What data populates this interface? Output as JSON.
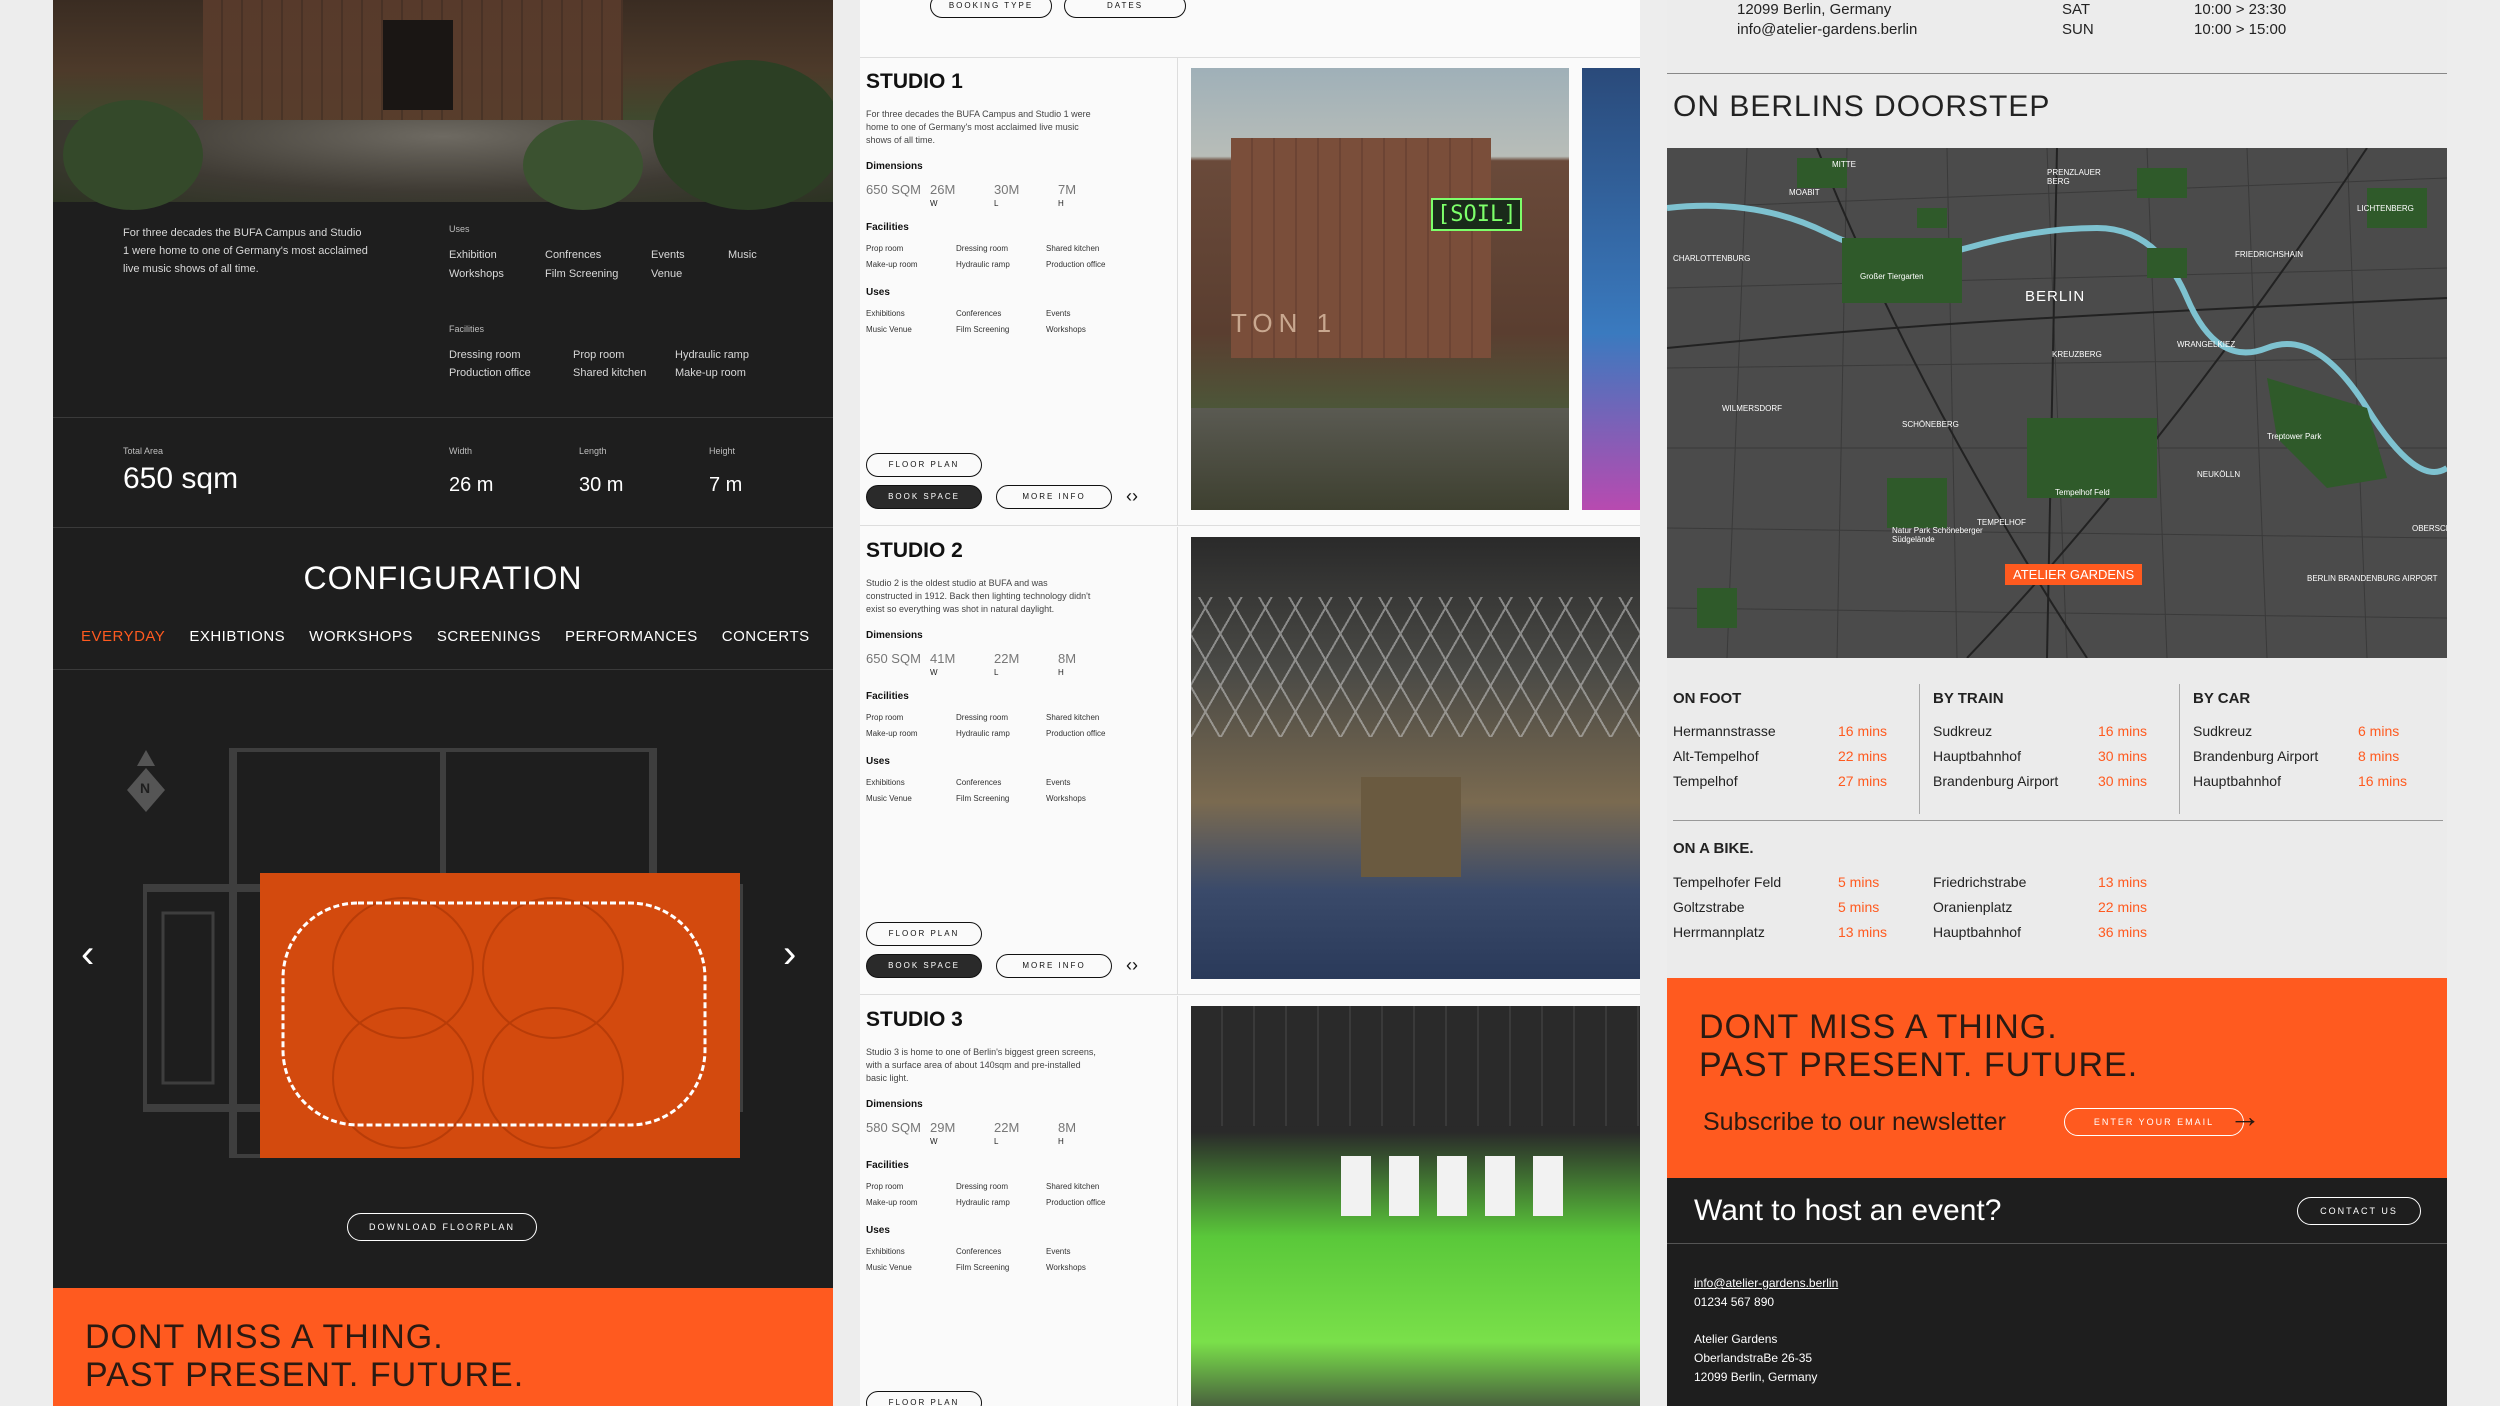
{
  "left": {
    "intro": "For three decades the BUFA Campus and Studio 1 were home to one of Germany's most acclaimed live music shows of all time.",
    "uses_label": "Uses",
    "uses": [
      "Exhibition",
      "Confrences",
      "Events",
      "Music",
      "Workshops",
      "Film Screening",
      "Venue"
    ],
    "facilities_label": "Facilities",
    "facilities": [
      "Dressing room",
      "Prop room",
      "Hydraulic ramp",
      "Production office",
      "Shared kitchen",
      "Make-up room"
    ],
    "total_area_label": "Total Area",
    "total_area": "650 sqm",
    "width_label": "Width",
    "width": "26 m",
    "length_label": "Length",
    "length": "30 m",
    "height_label": "Height",
    "height": "7 m",
    "config_title": "CONFIGURATION",
    "tabs": [
      "EVERYDAY",
      "EXHIBTIONS",
      "WORKSHOPS",
      "SCREENINGS",
      "PERFORMANCES",
      "CONCERTS"
    ],
    "compass": "N",
    "prev": "‹",
    "next": "›",
    "download": "DOWNLOAD FLOORPLAN",
    "newsletter_l1": "DONT MISS A THING.",
    "newsletter_l2": "PAST PRESENT. FUTURE."
  },
  "mid": {
    "booking_type": "BOOKING TYPE",
    "dates": "DATES",
    "floor_plan": "FLOOR PLAN",
    "book_space": "BOOK SPACE",
    "more_info": "MORE INFO",
    "studios": [
      {
        "name": "STUDIO 1",
        "desc": "For three decades the BUFA Campus and Studio 1 were home to one of Germany's most acclaimed live music shows of all time.",
        "dims": [
          "650 SQM",
          "26M",
          "30M",
          "7M"
        ],
        "sign": "[SOIL]",
        "building": "TON 1"
      },
      {
        "name": "STUDIO 2",
        "desc": "Studio 2 is the oldest studio at BUFA and was constructed in 1912. Back then lighting technology didn't exist so everything was shot in natural daylight.",
        "dims": [
          "650 SQM",
          "41M",
          "22M",
          "8M"
        ]
      },
      {
        "name": "STUDIO 3",
        "desc": "Studio 3 is home to one of Berlin's biggest green screens, with a surface area of about 140sqm and pre-installed basic light.",
        "dims": [
          "580 SQM",
          "29M",
          "22M",
          "8M"
        ]
      }
    ],
    "dim_sub": [
      "W",
      "L",
      "H"
    ],
    "dimensions_label": "Dimensions",
    "facilities_label": "Facilities",
    "uses_label": "Uses",
    "facilities": [
      "Prop room",
      "Dressing room",
      "Shared kitchen",
      "Make-up room",
      "Hydraulic ramp",
      "Production office"
    ],
    "uses": [
      "Exhibitions",
      "Conferences",
      "Events",
      "Music Venue",
      "Film Screening",
      "Workshops"
    ]
  },
  "right": {
    "address": "12099 Berlin, Germany",
    "email_top": "info@atelier-gardens.berlin",
    "sat": "SAT",
    "sun": "SUN",
    "sat_hours": "10:00 > 23:30",
    "sun_hours": "10:00 > 15:00",
    "map_title": "ON BERLINS DOORSTEP",
    "map_labels": {
      "mitte": "MITTE",
      "moabit": "MOABIT",
      "prenzlauer": "PRENZLAUER BERG",
      "lichtenberg": "LICHTENBERG",
      "charlottenburg": "CHARLOTTENBURG",
      "friedrichshain": "FRIEDRICHSHAIN",
      "tiergarten": "Großer Tiergarten",
      "berlin": "BERLIN",
      "kreuzberg": "KREUZBERG",
      "wrangel": "WRANGELKIEZ",
      "wilmersdorf": "WILMERSDORF",
      "schoneberg": "SCHÖNEBERG",
      "treptower": "Treptower Park",
      "tempelhoffeld": "Tempelhof Feld",
      "neukolln": "NEUKÖLLN",
      "natur": "Natur Park Schöneberger Südgelände",
      "tempelhof": "TEMPELHOF",
      "oberschone": "OBERSCHÖ",
      "airport": "BERLIN BRANDENBURG AIRPORT",
      "atelier": "ATELIER GARDENS"
    },
    "on_foot": "ON FOOT",
    "by_train": "BY TRAIN",
    "by_car": "BY CAR",
    "on_bike": "ON A BIKE.",
    "foot_rows": [
      [
        "Hermannstrasse",
        "16 mins"
      ],
      [
        "Alt-Tempelhof",
        "22 mins"
      ],
      [
        "Tempelhof",
        "27 mins"
      ]
    ],
    "train_rows": [
      [
        "Sudkreuz",
        "16 mins"
      ],
      [
        "Hauptbahnhof",
        "30 mins"
      ],
      [
        "Brandenburg Airport",
        "30 mins"
      ]
    ],
    "car_rows": [
      [
        "Sudkreuz",
        "6 mins"
      ],
      [
        "Brandenburg Airport",
        "8 mins"
      ],
      [
        "Hauptbahnhof",
        "16 mins"
      ]
    ],
    "bike_rows_a": [
      [
        "Tempelhofer Feld",
        "5 mins"
      ],
      [
        "Goltzstrabe",
        "5 mins"
      ],
      [
        "Herrmannplatz",
        "13 mins"
      ]
    ],
    "bike_rows_b": [
      [
        "Friedrichstrabe",
        "13 mins"
      ],
      [
        "Oranienplatz",
        "22 mins"
      ],
      [
        "Hauptbahnhof",
        "36 mins"
      ]
    ],
    "news_l1": "DONT MISS A THING.",
    "news_l2": "PAST PRESENT. FUTURE.",
    "subscribe": "Subscribe to our newsletter",
    "enter_email": "ENTER YOUR EMAIL",
    "host": "Want to host an event?",
    "contact": "CONTACT US",
    "foot_email": "info@atelier-gardens.berlin",
    "phone": "01234 567 890",
    "company": "Atelier Gardens",
    "street": "OberlandstraBe 26-35",
    "city": "12099 Berlin, Germany"
  }
}
